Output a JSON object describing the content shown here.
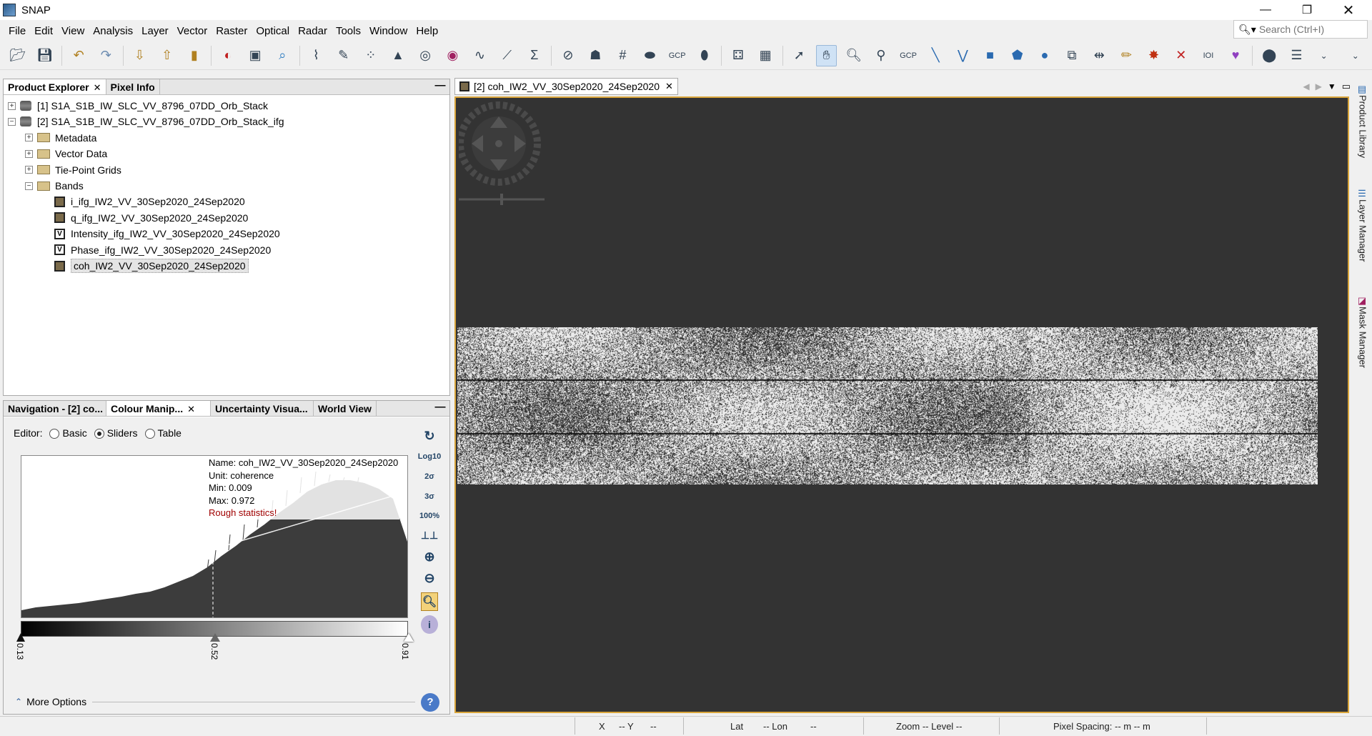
{
  "window": {
    "title": "SNAP",
    "search_placeholder": "Search (Ctrl+I)"
  },
  "menu": [
    "File",
    "Edit",
    "View",
    "Analysis",
    "Layer",
    "Vector",
    "Raster",
    "Optical",
    "Radar",
    "Tools",
    "Window",
    "Help"
  ],
  "toolbar_icons": [
    "open-product-icon",
    "save-icon",
    "undo-icon",
    "redo-icon",
    "import-icon",
    "export-icon",
    "session-icon",
    "rgb-image-icon",
    "band-maths-icon",
    "search-product-icon",
    "spectrum-icon",
    "edit-icon",
    "scatter-plot-icon",
    "histogram-icon",
    "statistics-icon",
    "profile-plot-icon",
    "information-icon",
    "sigma-icon",
    "geo-coding-icon",
    "world-map-icon",
    "graticule-icon",
    "mask-icon",
    "gcp-tool-icon",
    "pin-icon",
    "graph-builder-icon",
    "batch-processing-icon",
    "select-tool-icon",
    "pan-tool-icon",
    "zoom-tool-icon",
    "magnifier-tool-icon",
    "gcp-placing-icon",
    "line-tool-icon",
    "polyline-tool-icon",
    "rectangle-tool-icon",
    "polygon-tool-icon",
    "ellipse-tool-icon",
    "insert-figure-icon",
    "range-finder-icon",
    "pencil-icon",
    "star-icon",
    "cross-icon",
    "binary-icon",
    "hearts-icon",
    "sync-icon",
    "layers-icon",
    "dropdown-icon"
  ],
  "product_explorer": {
    "tabs": [
      {
        "label": "Product Explorer",
        "closable": true
      },
      {
        "label": "Pixel Info",
        "closable": false
      }
    ],
    "tree": [
      {
        "label": "[1] S1A_S1B_IW_SLC_VV_8796_07DD_Orb_Stack",
        "icon": "database-icon",
        "expander": "+"
      },
      {
        "label": "[2] S1A_S1B_IW_SLC_VV_8796_07DD_Orb_Stack_ifg",
        "icon": "database-icon",
        "expander": "−"
      },
      {
        "label": "Metadata",
        "icon": "folder-icon",
        "expander": "+"
      },
      {
        "label": "Vector Data",
        "icon": "folder-icon",
        "expander": "+"
      },
      {
        "label": "Tie-Point Grids",
        "icon": "folder-icon",
        "expander": "+"
      },
      {
        "label": "Bands",
        "icon": "folder-open-icon",
        "expander": "−"
      },
      {
        "label": "i_ifg_IW2_VV_30Sep2020_24Sep2020",
        "icon": "band-icon",
        "expander": ""
      },
      {
        "label": "q_ifg_IW2_VV_30Sep2020_24Sep2020",
        "icon": "band-icon",
        "expander": ""
      },
      {
        "label": "Intensity_ifg_IW2_VV_30Sep2020_24Sep2020",
        "icon": "virtual-band-icon",
        "expander": ""
      },
      {
        "label": "Phase_ifg_IW2_VV_30Sep2020_24Sep2020",
        "icon": "virtual-band-icon",
        "expander": ""
      },
      {
        "label": "coh_IW2_VV_30Sep2020_24Sep2020",
        "icon": "band-icon",
        "expander": "",
        "selected": true
      }
    ]
  },
  "lower_panel": {
    "tabs": [
      {
        "label": "Navigation - [2] co...",
        "closable": false
      },
      {
        "label": "Colour Manip...",
        "closable": true
      },
      {
        "label": "Uncertainty Visua...",
        "closable": false
      },
      {
        "label": "World View",
        "closable": false
      }
    ],
    "editor_label": "Editor:",
    "editor_modes": [
      {
        "label": "Basic",
        "selected": false
      },
      {
        "label": "Sliders",
        "selected": true
      },
      {
        "label": "Table",
        "selected": false
      }
    ],
    "info": {
      "name": "Name: coh_IW2_VV_30Sep2020_24Sep2020",
      "unit": "Unit: coherence",
      "min": "Min: 0.009",
      "max": "Max: 0.972",
      "warning": "Rough statistics!"
    },
    "sliders": [
      "0.13",
      "0.52",
      "0.91"
    ],
    "side_buttons": [
      "Log10",
      "2σ",
      "3σ",
      "100%"
    ],
    "more_options": "More Options",
    "histogram_color": "#3c3c3c"
  },
  "image_view": {
    "tab_label": "[2] coh_IW2_VV_30Sep2020_24Sep2020",
    "background": "#333333",
    "border_color": "#d9a53b"
  },
  "right_sidebar": [
    "Product Library",
    "Layer Manager",
    "Mask Manager"
  ],
  "status": {
    "x": "X",
    "x_val": "-- Y",
    "y_val": "--",
    "lat": "Lat",
    "lat_val": "-- Lon",
    "lon_val": "--",
    "zoom": "Zoom -- Level --",
    "spacing": "Pixel Spacing: -- m -- m"
  }
}
